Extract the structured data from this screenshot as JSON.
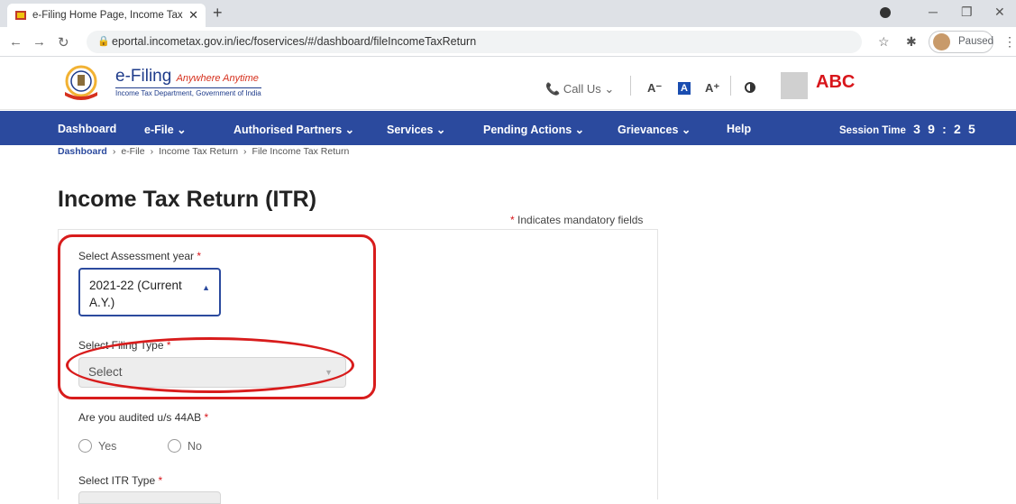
{
  "browser": {
    "tab_title": "e-Filing Home Page, Income Tax",
    "new_tab": "+",
    "url": "eportal.incometax.gov.in/iec/foservices/#/dashboard/fileIncomeTaxReturn",
    "profile_status": "Paused"
  },
  "site": {
    "brand": "e-Filing",
    "tagline": "Anywhere Anytime",
    "department": "Income Tax Department, Government of India",
    "call_us": "Call Us",
    "font_decrease": "A⁻",
    "font_normal": "A",
    "font_increase": "A⁺",
    "user_name": "ABC"
  },
  "nav": {
    "items": [
      {
        "label": "Dashboard"
      },
      {
        "label": "e-File ⌄"
      },
      {
        "label": "Authorised Partners ⌄"
      },
      {
        "label": "Services ⌄"
      },
      {
        "label": "Pending Actions ⌄"
      },
      {
        "label": "Grievances ⌄"
      },
      {
        "label": "Help"
      }
    ],
    "session_label": "Session Time",
    "session_digits": [
      "3",
      "9",
      ":",
      "2",
      "5"
    ]
  },
  "breadcrumb": [
    "Dashboard",
    "e-File",
    "Income Tax Return",
    "File Income Tax Return"
  ],
  "page": {
    "title": "Income Tax Return (ITR)",
    "mandatory_note": "Indicates mandatory fields",
    "star": "*"
  },
  "form": {
    "assessment_year_label": "Select Assessment year",
    "assessment_year_value": "2021-22 (Current A.Y.)",
    "filing_type_label": "Select Filing Type",
    "filing_type_placeholder": "Select",
    "audited_label": "Are you audited u/s 44AB",
    "audited_options": [
      "Yes",
      "No"
    ],
    "itr_type_label": "Select ITR Type"
  },
  "colors": {
    "nav_bg": "#2b4a9e",
    "annotation": "#d81c1c",
    "user_name": "#d8161b"
  }
}
